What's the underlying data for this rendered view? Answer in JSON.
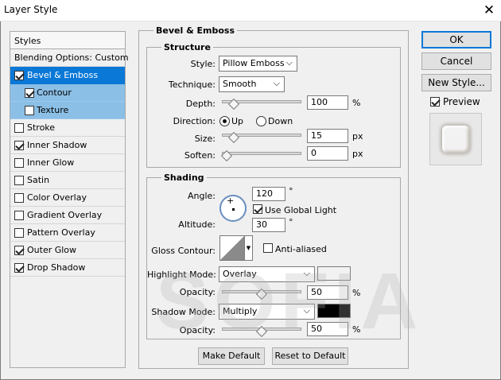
{
  "window": {
    "title": "Layer Style",
    "close_glyph": "✕"
  },
  "styles_list": {
    "header": "Styles",
    "blending": "Blending Options: Custom",
    "items": [
      {
        "label": "Bevel & Emboss",
        "checked": true
      },
      {
        "label": "Contour",
        "checked": true
      },
      {
        "label": "Texture",
        "checked": false
      },
      {
        "label": "Stroke",
        "checked": false
      },
      {
        "label": "Inner Shadow",
        "checked": true
      },
      {
        "label": "Inner Glow",
        "checked": false
      },
      {
        "label": "Satin",
        "checked": false
      },
      {
        "label": "Color Overlay",
        "checked": false
      },
      {
        "label": "Gradient Overlay",
        "checked": false
      },
      {
        "label": "Pattern Overlay",
        "checked": false
      },
      {
        "label": "Outer Glow",
        "checked": true
      },
      {
        "label": "Drop Shadow",
        "checked": true
      }
    ]
  },
  "bevel": {
    "group_title": "Bevel & Emboss",
    "structure_title": "Structure",
    "style_label": "Style:",
    "style_value": "Pillow Emboss",
    "technique_label": "Technique:",
    "technique_value": "Smooth",
    "depth_label": "Depth:",
    "depth_value": "100",
    "depth_unit": "%",
    "depth_fraction": 0.1,
    "direction_label": "Direction:",
    "dir_up": "Up",
    "dir_down": "Down",
    "direction_selected": "Up",
    "size_label": "Size:",
    "size_value": "15",
    "size_unit": "px",
    "size_fraction": 0.1,
    "soften_label": "Soften:",
    "soften_value": "0",
    "soften_unit": "px",
    "soften_fraction": 0.0
  },
  "shading": {
    "title": "Shading",
    "angle_label": "Angle:",
    "angle_value": "120",
    "angle_unit": "°",
    "global_light_label": "Use Global Light",
    "global_light_checked": true,
    "altitude_label": "Altitude:",
    "altitude_value": "30",
    "altitude_unit": "°",
    "gloss_label": "Gloss Contour:",
    "anti_aliased_label": "Anti-aliased",
    "anti_aliased_checked": false,
    "highlight_label": "Highlight Mode:",
    "highlight_value": "Overlay",
    "highlight_color": "#f2f2f2",
    "hl_opacity_label": "Opacity:",
    "hl_opacity_value": "50",
    "hl_opacity_unit": "%",
    "hl_opacity_fraction": 0.5,
    "shadow_label": "Shadow Mode:",
    "shadow_value": "Multiply",
    "shadow_color": "#000000",
    "sh_opacity_label": "Opacity:",
    "sh_opacity_value": "50",
    "sh_opacity_unit": "%",
    "sh_opacity_fraction": 0.5
  },
  "footer": {
    "make_default": "Make Default",
    "reset_default": "Reset to Default"
  },
  "right": {
    "ok": "OK",
    "cancel": "Cancel",
    "new_style": "New Style...",
    "preview_label": "Preview",
    "preview_checked": true
  },
  "watermark": "SOFIA",
  "colors": {
    "selection": "#0a78d7",
    "sub_selection": "#8bbfe6",
    "dial_border": "#6a8ec0"
  }
}
